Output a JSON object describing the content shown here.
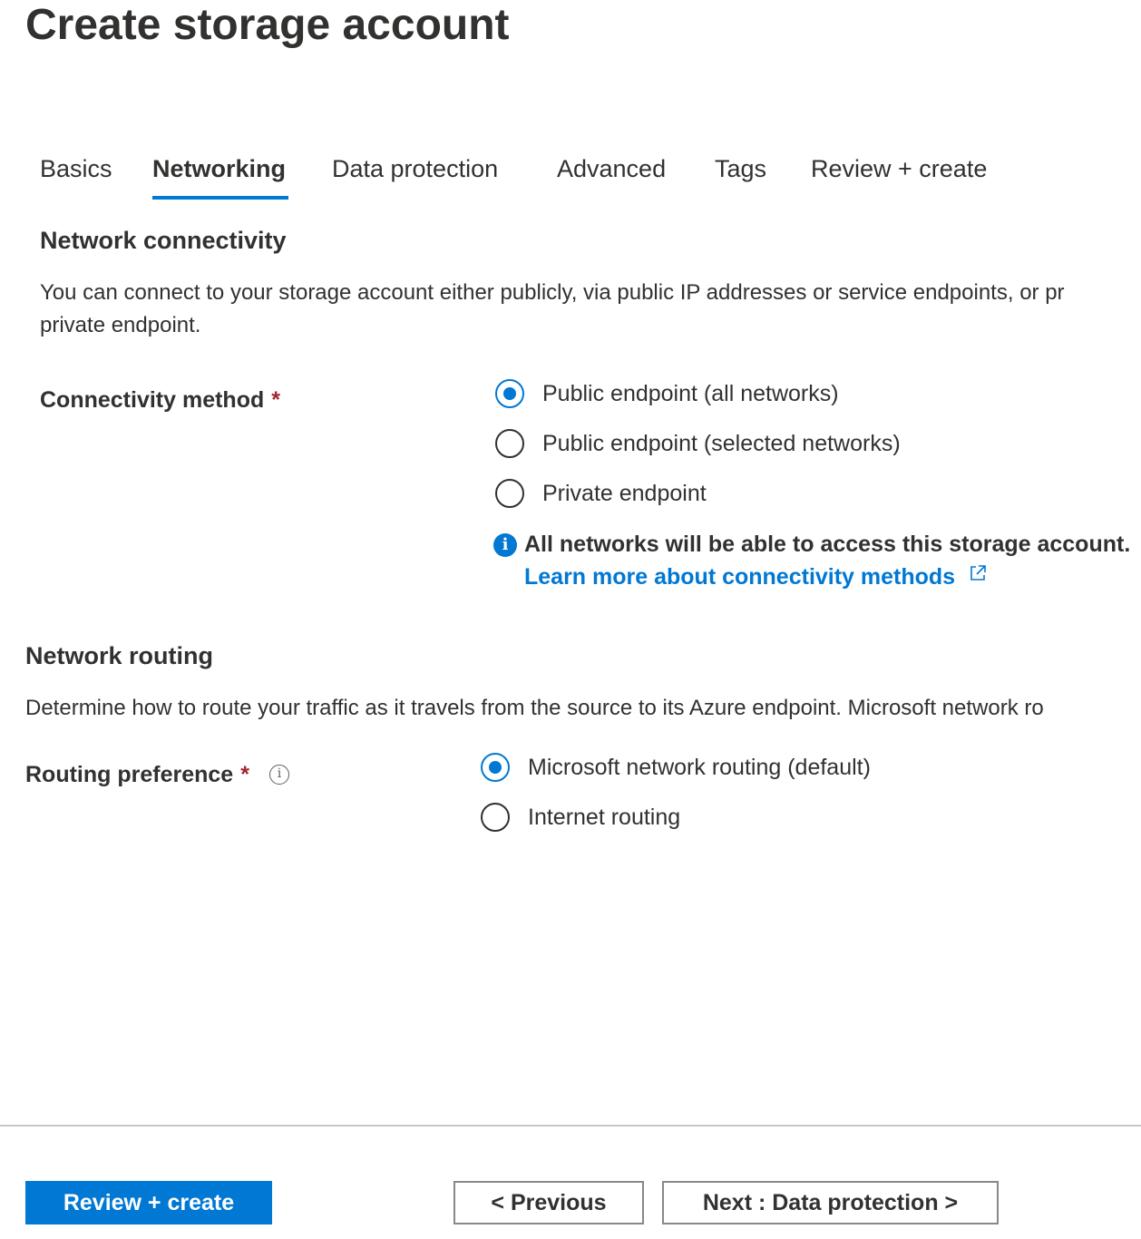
{
  "page": {
    "title": "Create storage account"
  },
  "tabs": [
    {
      "label": "Basics"
    },
    {
      "label": "Networking",
      "active": true
    },
    {
      "label": "Data protection"
    },
    {
      "label": "Advanced"
    },
    {
      "label": "Tags"
    },
    {
      "label": "Review + create"
    }
  ],
  "network_connectivity": {
    "title": "Network connectivity",
    "description_line1": "You can connect to your storage account either publicly, via public IP addresses or service endpoints, or pr",
    "description_line2": "private endpoint.",
    "field_label": "Connectivity method",
    "required_mark": "*",
    "options": [
      {
        "label": "Public endpoint (all networks)",
        "checked": true
      },
      {
        "label": "Public endpoint (selected networks)",
        "checked": false
      },
      {
        "label": "Private endpoint",
        "checked": false
      }
    ],
    "info_message": "All networks will be able to access this storage account.",
    "learn_more_link": "Learn more about connectivity methods"
  },
  "network_routing": {
    "title": "Network routing",
    "description": "Determine how to route your traffic as it travels from the source to its Azure endpoint. Microsoft network ro",
    "field_label": "Routing preference",
    "required_mark": "*",
    "options": [
      {
        "label": "Microsoft network routing (default)",
        "checked": true
      },
      {
        "label": "Internet routing",
        "checked": false
      }
    ]
  },
  "footer": {
    "review_create_label": "Review + create",
    "previous_label": "< Previous",
    "next_label": "Next : Data protection >"
  },
  "colors": {
    "accent": "#0078d4",
    "required": "#a4262c",
    "text": "#323130"
  },
  "icons": {
    "info": "info-icon",
    "external_link": "external-link-icon",
    "tooltip": "info-outline-icon"
  }
}
